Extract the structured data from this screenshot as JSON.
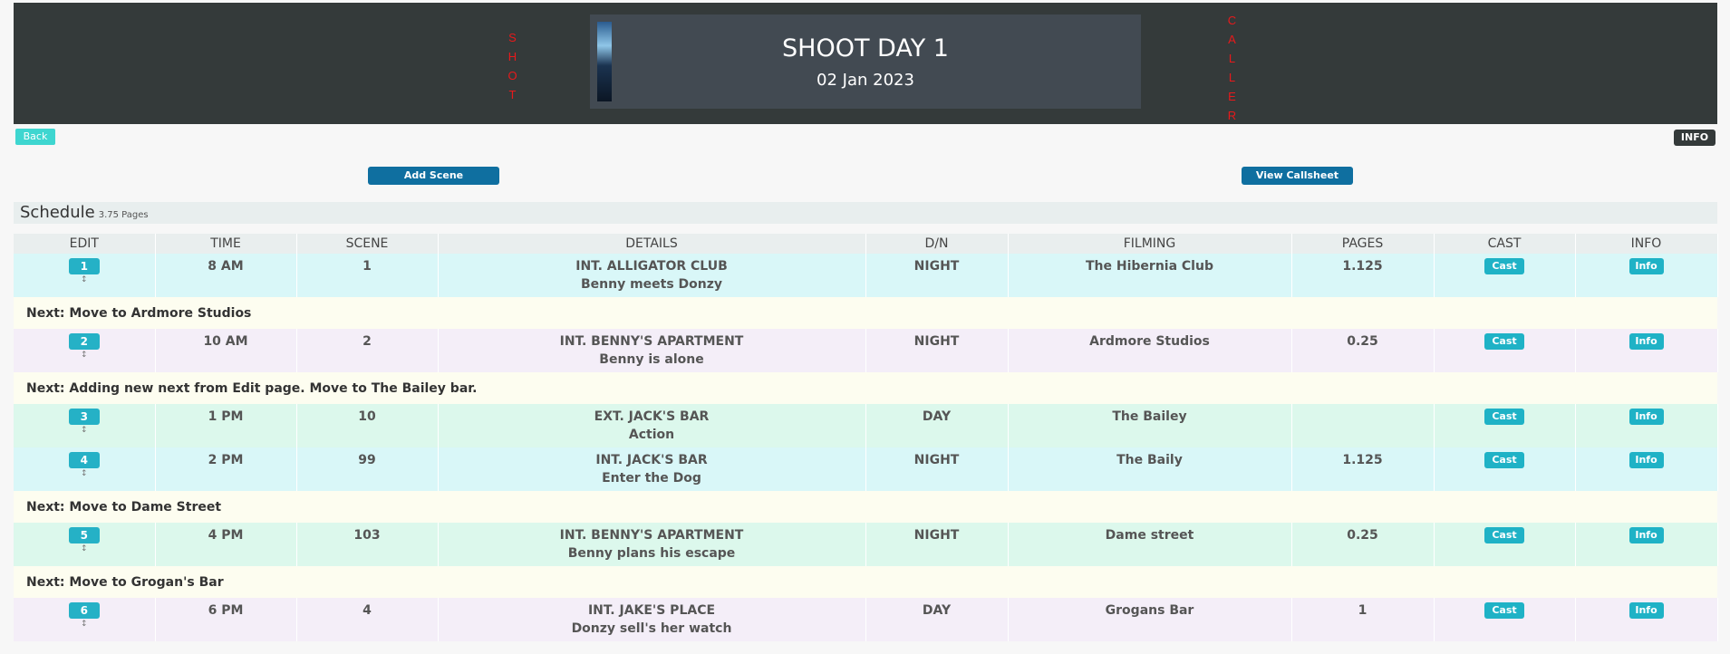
{
  "header": {
    "left_vertical": [
      "S",
      "H",
      "O",
      "T"
    ],
    "right_vertical": [
      "C",
      "A",
      "L",
      "L",
      "E",
      "R"
    ],
    "title": "SHOOT DAY 1",
    "date": "02 Jan 2023"
  },
  "buttons": {
    "back": "Back",
    "info": "INFO",
    "add_scene": "Add Scene",
    "view_callsheet": "View Callsheet"
  },
  "schedule": {
    "title": "Schedule",
    "pages": "3.75 Pages",
    "columns": [
      "EDIT",
      "TIME",
      "SCENE",
      "DETAILS",
      "D/N",
      "FILMING",
      "PAGES",
      "CAST",
      "INFO"
    ],
    "rows": [
      {
        "type": "scene",
        "color": "cyan",
        "num": "1",
        "sub": "↕",
        "time": "8 AM",
        "scene": "1",
        "heading": "INT. ALLIGATOR CLUB",
        "desc": "Benny meets Donzy",
        "dn": "NIGHT",
        "filming": "The Hibernia Club",
        "pages": "1.125",
        "cast": "Cast",
        "info": "Info"
      },
      {
        "type": "next",
        "text": "Next: Move to Ardmore Studios"
      },
      {
        "type": "scene",
        "color": "purple",
        "num": "2",
        "sub": "↕",
        "time": "10 AM",
        "scene": "2",
        "heading": "INT. BENNY'S APARTMENT",
        "desc": "Benny is alone",
        "dn": "NIGHT",
        "filming": "Ardmore Studios",
        "pages": "0.25",
        "cast": "Cast",
        "info": "Info"
      },
      {
        "type": "next",
        "text": "Next: Adding new next from Edit page. Move to The Bailey bar."
      },
      {
        "type": "scene",
        "color": "green",
        "num": "3",
        "sub": "↕",
        "time": "1 PM",
        "scene": "10",
        "heading": "EXT. JACK'S BAR",
        "desc": "Action",
        "dn": "DAY",
        "filming": "The Bailey",
        "pages": "",
        "cast": "Cast",
        "info": "Info"
      },
      {
        "type": "scene",
        "color": "cyan",
        "num": "4",
        "sub": "↕",
        "time": "2 PM",
        "scene": "99",
        "heading": "INT. JACK'S BAR",
        "desc": "Enter the Dog",
        "dn": "NIGHT",
        "filming": "The Baily",
        "pages": "1.125",
        "cast": "Cast",
        "info": "Info"
      },
      {
        "type": "next",
        "text": "Next: Move to Dame Street"
      },
      {
        "type": "scene",
        "color": "green",
        "num": "5",
        "sub": "↕",
        "time": "4 PM",
        "scene": "103",
        "heading": "INT. BENNY'S APARTMENT",
        "desc": "Benny plans his escape",
        "dn": "NIGHT",
        "filming": "Dame street",
        "pages": "0.25",
        "cast": "Cast",
        "info": "Info"
      },
      {
        "type": "next",
        "text": "Next: Move to Grogan's Bar"
      },
      {
        "type": "scene",
        "color": "purple",
        "num": "6",
        "sub": "↕",
        "time": "6 PM",
        "scene": "4",
        "heading": "INT. JAKE'S PLACE",
        "desc": "Donzy sell's her watch",
        "dn": "DAY",
        "filming": "Grogans Bar",
        "pages": "1",
        "cast": "Cast",
        "info": "Info"
      }
    ]
  }
}
